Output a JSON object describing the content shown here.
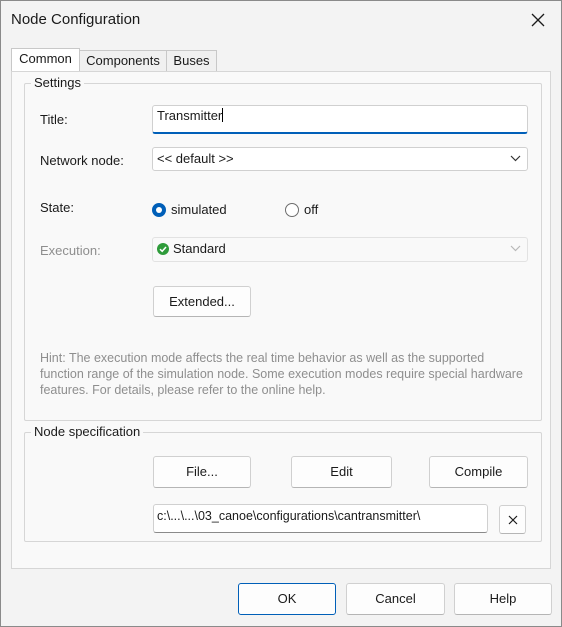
{
  "window": {
    "title": "Node Configuration"
  },
  "tabs": [
    {
      "label": "Common",
      "active": true
    },
    {
      "label": "Components",
      "active": false
    },
    {
      "label": "Buses",
      "active": false
    }
  ],
  "settings": {
    "legend": "Settings",
    "title_label": "Title:",
    "title_value": "Transmitter",
    "network_node_label": "Network node:",
    "network_node_value": "<< default >>",
    "state_label": "State:",
    "state_options": [
      {
        "label": "simulated",
        "checked": true
      },
      {
        "label": "off",
        "checked": false
      }
    ],
    "execution_label": "Execution:",
    "execution_value": "Standard",
    "execution_icon": "check-circle-icon",
    "extended_button": "Extended...",
    "hint": "Hint: The execution mode affects the real time behavior as well as the supported function range of the simulation node. Some execution modes require special hardware features. For details, please refer to the online help."
  },
  "node_spec": {
    "legend": "Node specification",
    "file_button": "File...",
    "edit_button": "Edit",
    "compile_button": "Compile",
    "path": "c:\\...\\...\\03_canoe\\configurations\\cantransmitter\\",
    "clear_icon": "close-icon"
  },
  "footer": {
    "ok": "OK",
    "cancel": "Cancel",
    "help": "Help"
  },
  "colors": {
    "accent": "#005fb8",
    "check_green": "#2e9b3a"
  }
}
